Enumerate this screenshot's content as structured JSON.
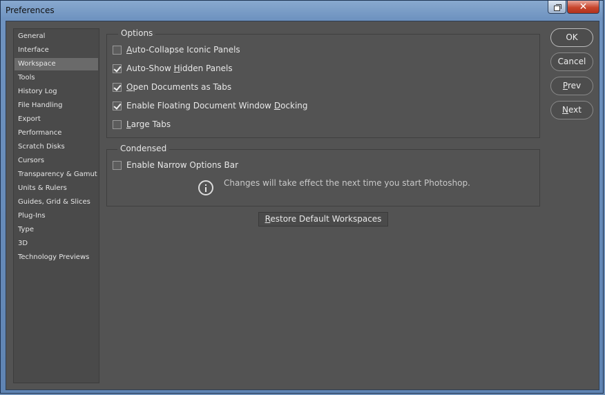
{
  "window": {
    "title": "Preferences"
  },
  "sidebar": {
    "items": [
      {
        "label": "General",
        "active": false
      },
      {
        "label": "Interface",
        "active": false
      },
      {
        "label": "Workspace",
        "active": true
      },
      {
        "label": "Tools",
        "active": false
      },
      {
        "label": "History Log",
        "active": false
      },
      {
        "label": "File Handling",
        "active": false
      },
      {
        "label": "Export",
        "active": false
      },
      {
        "label": "Performance",
        "active": false
      },
      {
        "label": "Scratch Disks",
        "active": false
      },
      {
        "label": "Cursors",
        "active": false
      },
      {
        "label": "Transparency & Gamut",
        "active": false
      },
      {
        "label": "Units & Rulers",
        "active": false
      },
      {
        "label": "Guides, Grid & Slices",
        "active": false
      },
      {
        "label": "Plug-Ins",
        "active": false
      },
      {
        "label": "Type",
        "active": false
      },
      {
        "label": "3D",
        "active": false
      },
      {
        "label": "Technology Previews",
        "active": false
      }
    ]
  },
  "options": {
    "title": "Options",
    "checkboxes": [
      {
        "pre": "",
        "ul": "A",
        "post": "uto-Collapse Iconic Panels",
        "checked": false
      },
      {
        "pre": "Auto-Show ",
        "ul": "H",
        "post": "idden Panels",
        "checked": true
      },
      {
        "pre": "",
        "ul": "O",
        "post": "pen Documents as Tabs",
        "checked": true
      },
      {
        "pre": "Enable Floating Document Window ",
        "ul": "D",
        "post": "ocking",
        "checked": true
      },
      {
        "pre": "",
        "ul": "L",
        "post": "arge Tabs",
        "checked": false
      }
    ]
  },
  "condensed": {
    "title": "Condensed",
    "checkbox": {
      "pre": "Enable Narrow Options Bar",
      "ul": "",
      "post": "",
      "checked": false
    },
    "info_text": "Changes will take effect the next time you start Photoshop."
  },
  "restore_button": {
    "pre": "",
    "ul": "R",
    "post": "estore Default Workspaces"
  },
  "buttons": {
    "ok": {
      "pre": "OK",
      "ul": "",
      "post": ""
    },
    "cancel": {
      "pre": "Cancel",
      "ul": "",
      "post": ""
    },
    "prev": {
      "pre": "",
      "ul": "P",
      "post": "rev"
    },
    "next": {
      "pre": "",
      "ul": "N",
      "post": "ext"
    }
  }
}
